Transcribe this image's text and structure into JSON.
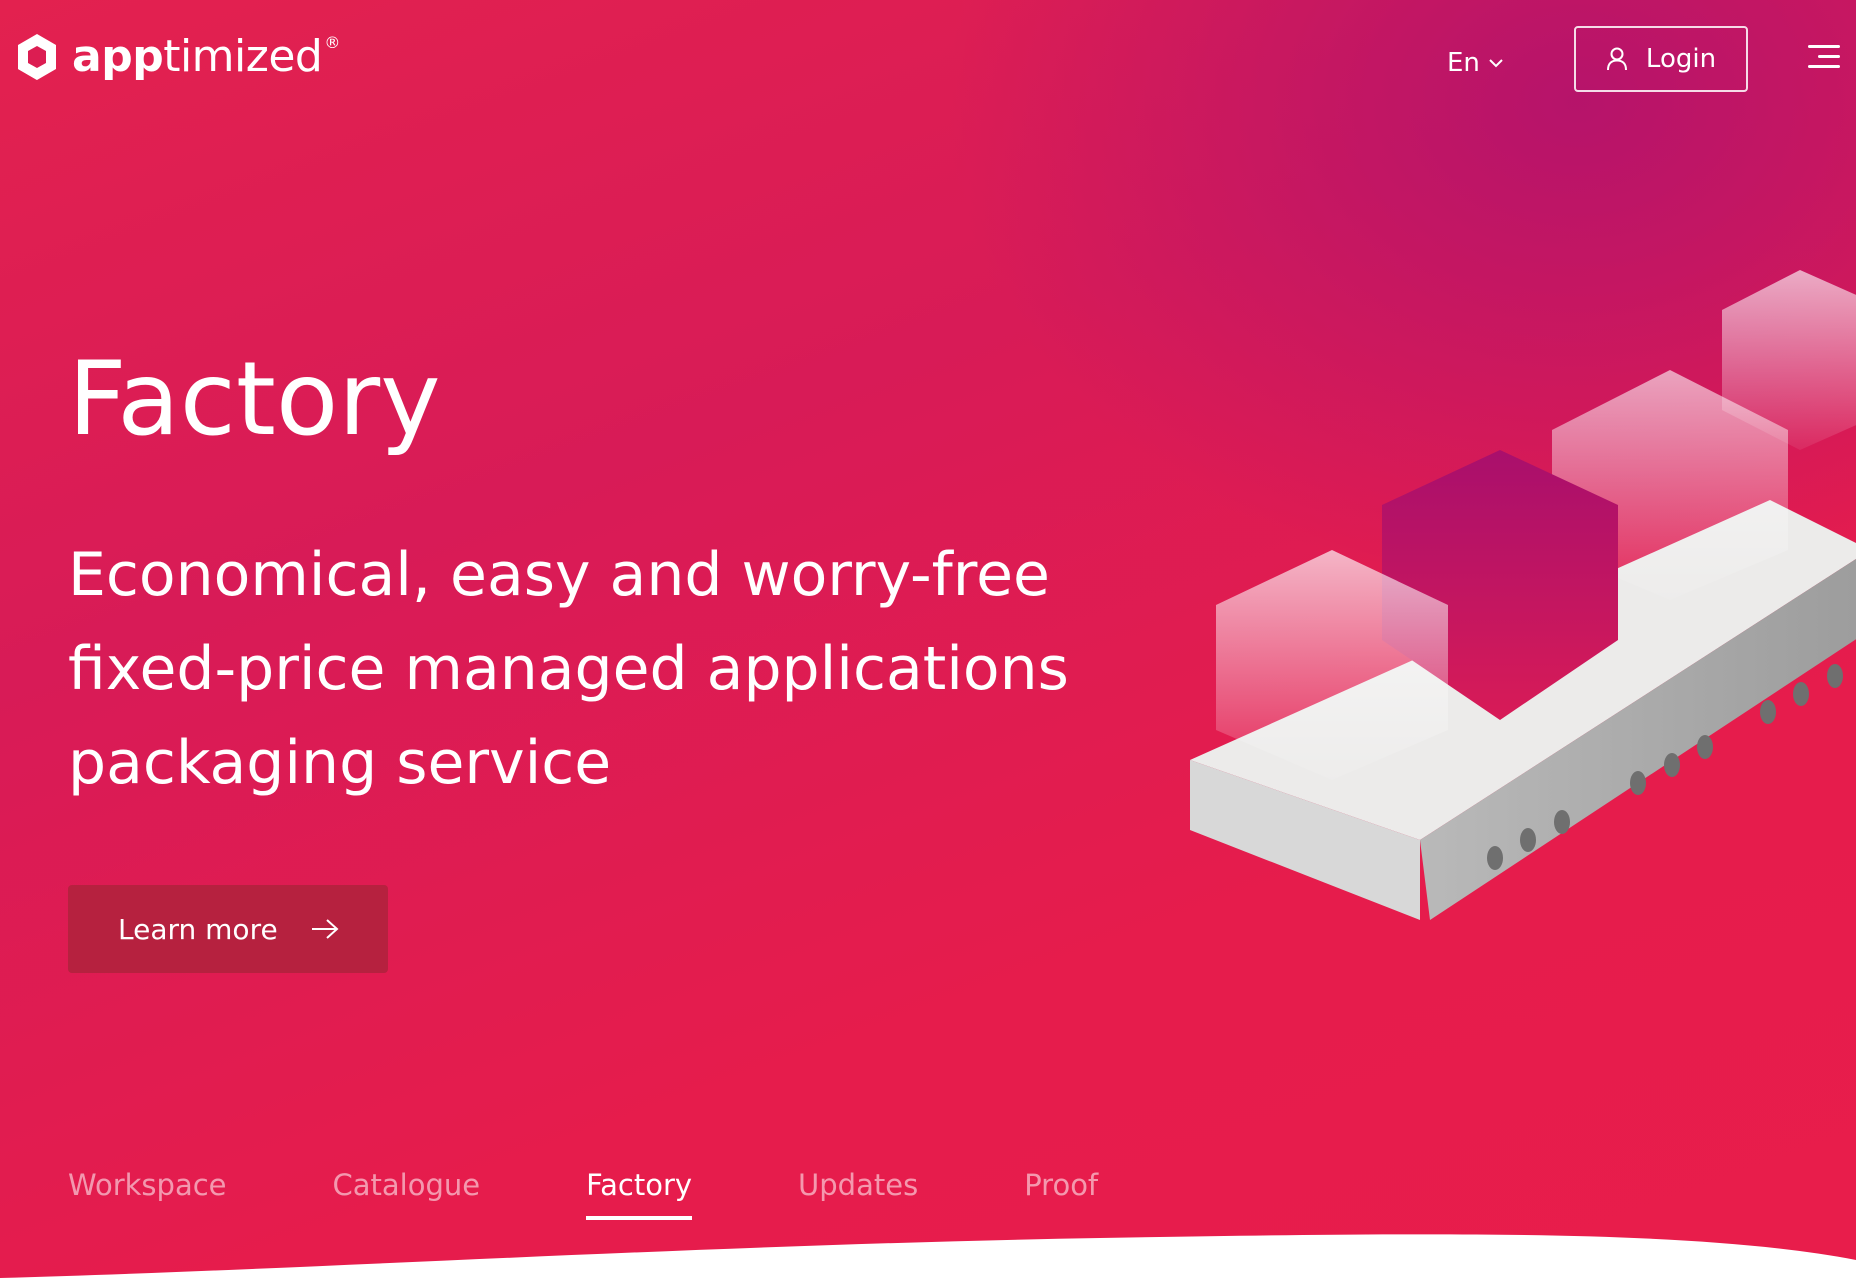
{
  "brand": {
    "name_bold": "app",
    "name_light": "timized",
    "registered": "®"
  },
  "header": {
    "language": "En",
    "login_label": "Login"
  },
  "hero": {
    "title": "Factory",
    "subtitle": "Economical, easy and worry-free fixed-price managed applications packaging service",
    "cta_label": "Learn more"
  },
  "tabs": [
    {
      "label": "Workspace",
      "active": false
    },
    {
      "label": "Catalogue",
      "active": false
    },
    {
      "label": "Factory",
      "active": true
    },
    {
      "label": "Updates",
      "active": false
    },
    {
      "label": "Proof",
      "active": false
    }
  ],
  "icons": {
    "logo": "hexagon-logo-icon",
    "language_toggle": "chevron-down-icon",
    "login": "user-icon",
    "menu": "hamburger-menu-icon",
    "cta": "arrow-right-icon"
  },
  "colors": {
    "accent": "#e61c4c",
    "deep": "#b0126e",
    "button": "#b6213f"
  }
}
